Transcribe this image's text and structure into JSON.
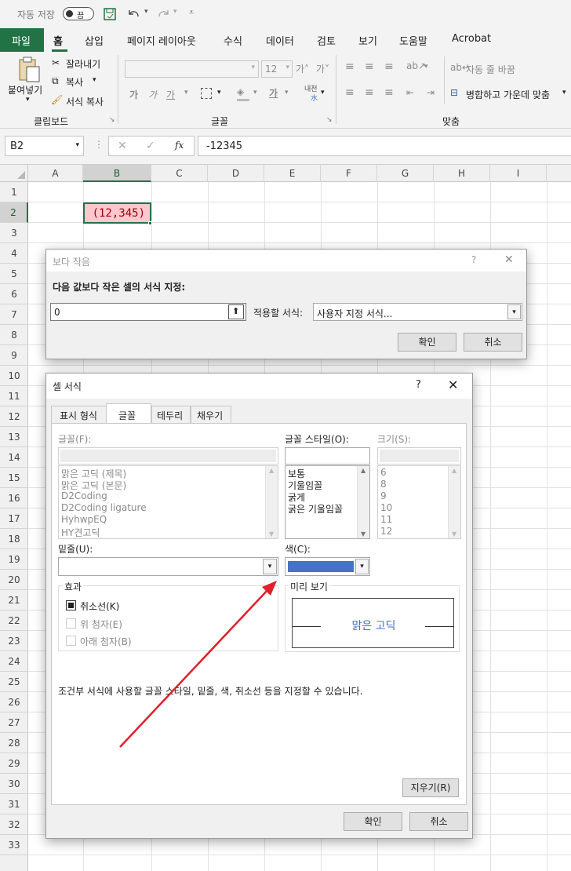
{
  "qat": {
    "autosave_label": "자동 저장",
    "autosave_state": "끔"
  },
  "tabs": [
    "파일",
    "홈",
    "삽입",
    "페이지 레이아웃",
    "수식",
    "데이터",
    "검토",
    "보기",
    "도움말",
    "Acrobat"
  ],
  "ribbon": {
    "clipboard": {
      "paste": "붙여넣기",
      "cut": "잘라내기",
      "copy": "복사",
      "format_painter": "서식 복사",
      "group": "클립보드"
    },
    "font": {
      "font_size": "12",
      "bold": "가",
      "italic": "가",
      "underline": "가",
      "group": "글꼴"
    },
    "align": {
      "wrap": "자동 줄 바꿈",
      "merge": "병합하고 가운데 맞춤",
      "group": "맞춤"
    }
  },
  "formula_bar": {
    "name_box": "B2",
    "fx": "fx",
    "value": "-12345"
  },
  "columns": [
    "A",
    "B",
    "C",
    "D",
    "E",
    "F",
    "G",
    "H",
    "I"
  ],
  "rows": [
    "1",
    "2",
    "3",
    "4",
    "5",
    "6",
    "7",
    "8",
    "9",
    "10",
    "11",
    "12",
    "13",
    "14",
    "15",
    "16",
    "17",
    "18",
    "19",
    "20",
    "21",
    "22",
    "23",
    "24",
    "25",
    "26",
    "27",
    "28",
    "29",
    "30",
    "31",
    "32",
    "33"
  ],
  "cell_b2": "(12,345)",
  "colors": {
    "accent": "#217346",
    "cell_fill": "#ffc7ce",
    "cell_text": "#9c0006",
    "preview_text": "#4472c4",
    "selected_color": "#4472c4",
    "arrow": "#e0202a"
  },
  "less_than_dialog": {
    "title": "보다 작음",
    "help": "?",
    "close": "✕",
    "prompt": "다음 값보다 작은 셀의 서식 지정:",
    "value": "0",
    "apply_label": "적용할 서식:",
    "format_value": "사용자 지정 서식...",
    "ok": "확인",
    "cancel": "취소"
  },
  "format_dialog": {
    "title": "셀 서식",
    "help": "?",
    "close": "✕",
    "tabs": [
      "표시 형식",
      "글꼴",
      "테두리",
      "채우기"
    ],
    "font_label": "글꼴(F):",
    "fonts": [
      "맑은 고딕 (제목)",
      "맑은 고딕 (본문)",
      "D2Coding",
      "D2Coding ligature",
      "HyhwpEQ",
      "HY견고딕"
    ],
    "style_label": "글꼴 스타일(O):",
    "styles": [
      "보통",
      "기울임꼴",
      "굵게",
      "굵은 기울임꼴"
    ],
    "size_label": "크기(S):",
    "sizes": [
      "6",
      "8",
      "9",
      "10",
      "11",
      "12"
    ],
    "underline_label": "밑줄(U):",
    "color_label": "색(C):",
    "effects_label": "효과",
    "strikethrough": "취소선(K)",
    "superscript": "위 첨자(E)",
    "subscript": "아래 첨자(B)",
    "preview_label": "미리 보기",
    "preview_text": "맑은 고딕",
    "note": "조건부 서식에 사용할 글꼴 스타일, 밑줄, 색, 취소선 등을 지정할 수 있습니다.",
    "clear": "지우기(R)",
    "ok": "확인",
    "cancel": "취소"
  }
}
